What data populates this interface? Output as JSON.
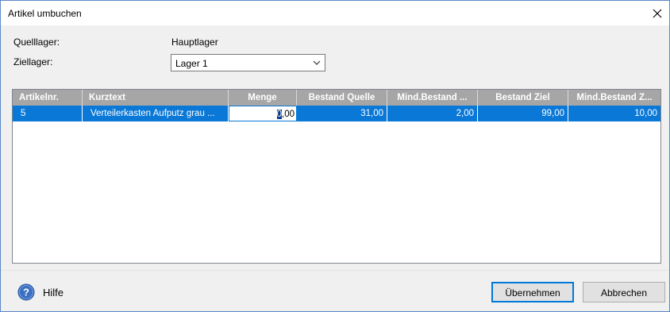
{
  "window": {
    "title": "Artikel umbuchen"
  },
  "form": {
    "source_label": "Quelllager:",
    "source_value": "Hauptlager",
    "target_label": "Ziellager:",
    "target_value": "Lager 1"
  },
  "grid": {
    "headers": [
      "Artikelnr.",
      "Kurztext",
      "Menge",
      "Bestand Quelle",
      "Mind.Bestand ...",
      "Bestand Ziel",
      "Mind.Bestand Z..."
    ],
    "rows": [
      {
        "artikelnr": "5",
        "kurztext": "Verteilerkasten Aufputz grau ...",
        "menge_first": "0",
        "menge_rest": ",00",
        "bestand_quelle": "31,00",
        "mind_bestand_quelle": "2,00",
        "bestand_ziel": "99,00",
        "mind_bestand_ziel": "10,00"
      }
    ]
  },
  "footer": {
    "help_label": "Hilfe",
    "apply_label": "Übernehmen",
    "cancel_label": "Abbrechen"
  },
  "colors": {
    "selection": "#0a78d7",
    "header": "#a6a6a6",
    "accent": "#0078d7"
  },
  "icons": [
    "close-icon",
    "chevron-down-icon",
    "help-icon"
  ]
}
